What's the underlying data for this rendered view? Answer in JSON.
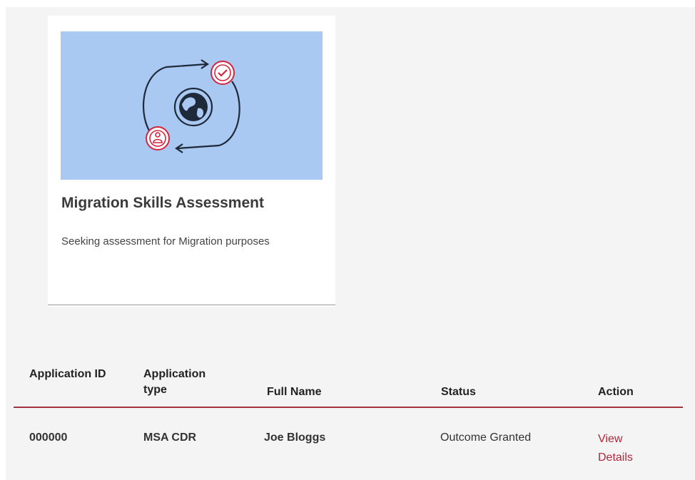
{
  "card": {
    "title": "Migration Skills Assessment",
    "description": "Seeking assessment for Migration purposes",
    "image_bg": "#a9c9f2",
    "accent": "#d5243d",
    "icons": [
      "globe-icon",
      "checkmark-icon",
      "person-icon",
      "cycle-arrows-icon"
    ]
  },
  "table": {
    "headers": {
      "application_id": "Application ID",
      "application_type": "Application type",
      "full_name": "Full Name",
      "status": "Status",
      "action": "Action"
    },
    "rows": [
      {
        "application_id": "000000",
        "application_type": "MSA CDR",
        "full_name": "Joe Bloggs",
        "status": "Outcome Granted",
        "action": "View Details"
      }
    ],
    "rule_color": "#a4323f"
  }
}
